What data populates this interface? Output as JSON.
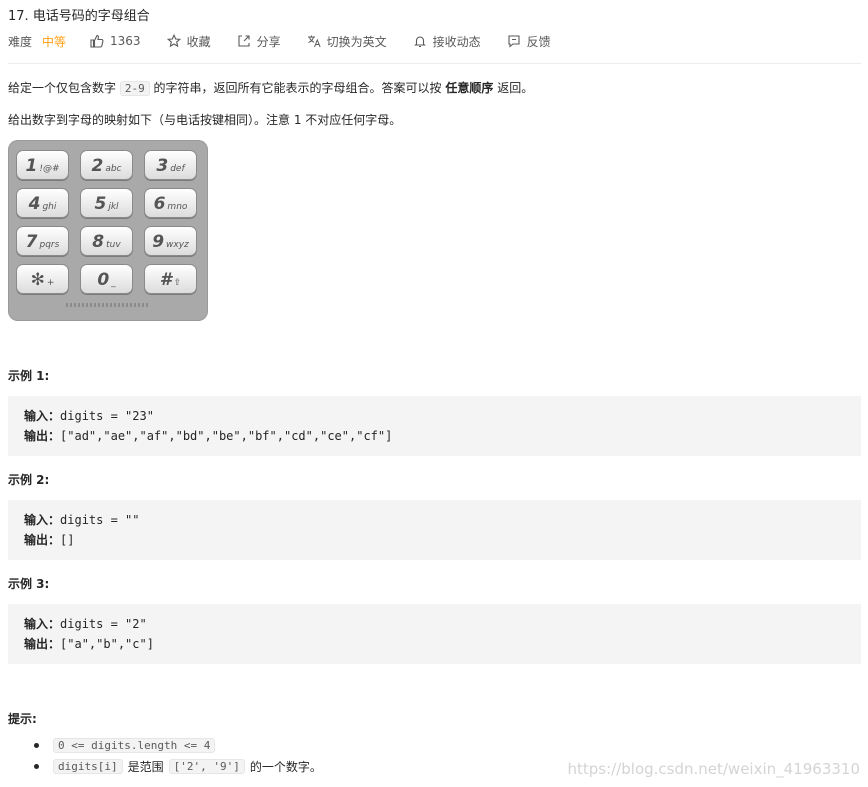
{
  "title": "17. 电话号码的字母组合",
  "meta": {
    "difficulty_label": "难度",
    "difficulty": "中等",
    "likes": "1363",
    "collect": "收藏",
    "share": "分享",
    "switch_lang": "切换为英文",
    "subscribe": "接收动态",
    "feedback": "反馈"
  },
  "description": {
    "p1_a": "给定一个仅包含数字",
    "p1_code": "2-9",
    "p1_b": "的字符串，返回所有它能表示的字母组合。答案可以按",
    "p1_bold": "任意顺序",
    "p1_c": "返回。",
    "p2": "给出数字到字母的映射如下（与电话按键相同）。注意 1 不对应任何字母。"
  },
  "keypad": {
    "keys": [
      {
        "digit": "1",
        "letters": "!@#"
      },
      {
        "digit": "2",
        "letters": "abc"
      },
      {
        "digit": "3",
        "letters": "def"
      },
      {
        "digit": "4",
        "letters": "ghi"
      },
      {
        "digit": "5",
        "letters": "jkl"
      },
      {
        "digit": "6",
        "letters": "mno"
      },
      {
        "digit": "7",
        "letters": "pqrs"
      },
      {
        "digit": "8",
        "letters": "tuv"
      },
      {
        "digit": "9",
        "letters": "wxyz"
      },
      {
        "digit": "✻",
        "letters": "+"
      },
      {
        "digit": "0",
        "letters": "_"
      },
      {
        "digit": "#",
        "letters": "⇧"
      }
    ]
  },
  "examples": [
    {
      "title": "示例 1:",
      "input_label": "输入：",
      "input": "digits = \"23\"",
      "output_label": "输出：",
      "output": "[\"ad\",\"ae\",\"af\",\"bd\",\"be\",\"bf\",\"cd\",\"ce\",\"cf\"]"
    },
    {
      "title": "示例 2:",
      "input_label": "输入：",
      "input": "digits = \"\"",
      "output_label": "输出：",
      "output": "[]"
    },
    {
      "title": "示例 3:",
      "input_label": "输入：",
      "input": "digits = \"2\"",
      "output_label": "输出：",
      "output": "[\"a\",\"b\",\"c\"]"
    }
  ],
  "hints": {
    "title": "提示:",
    "h1_code": "0 <= digits.length <= 4",
    "h2_code1": "digits[i]",
    "h2_text1": "是范围",
    "h2_code2": "['2', '9']",
    "h2_text2": "的一个数字。"
  },
  "watermark": "https://blog.csdn.net/weixin_41963310"
}
